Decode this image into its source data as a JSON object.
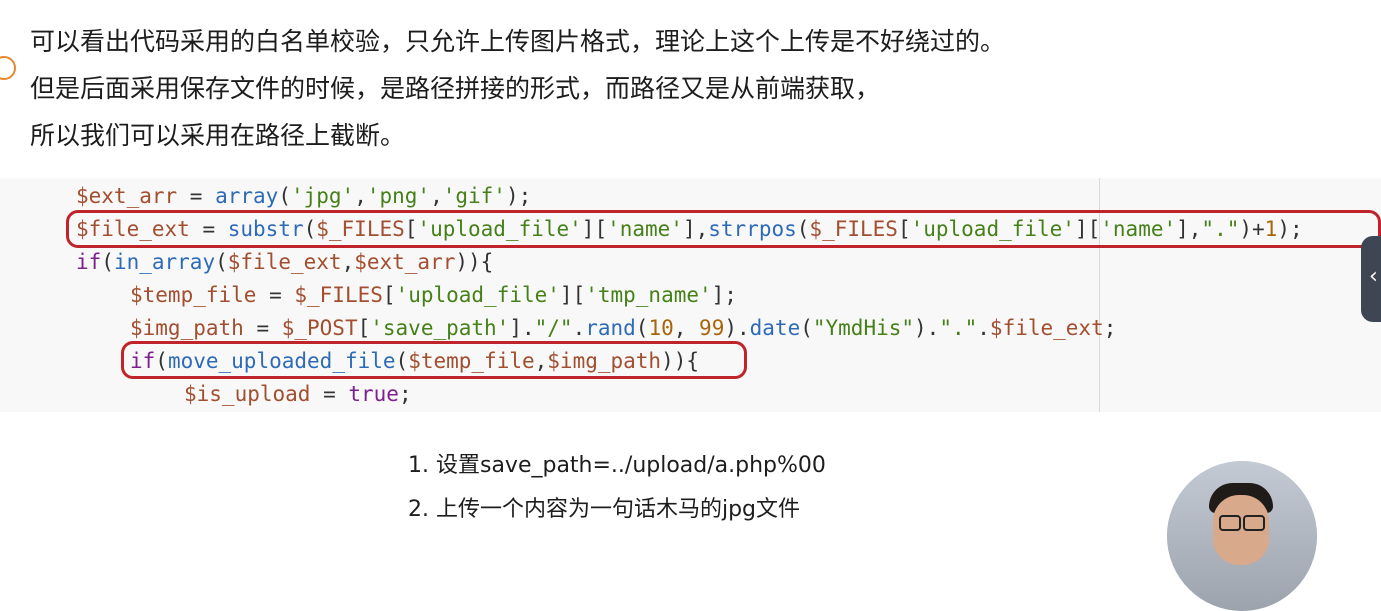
{
  "prose": {
    "line1": "可以看出代码采用的白名单校验，只允许上传图片格式，理论上这个上传是不好绕过的。",
    "line2": "但是后面采用保存文件的时候，是路径拼接的形式，而路径又是从前端获取，",
    "line3": "所以我们可以采用在路径上截断。"
  },
  "code": {
    "l1": {
      "var": "$ext_arr",
      "op1": " = ",
      "fn": "array",
      "p1": "(",
      "s1": "'jpg'",
      "c1": ",",
      "s2": "'png'",
      "c2": ",",
      "s3": "'gif'",
      "end": ");"
    },
    "l2": {
      "var": "$file_ext",
      "op1": " = ",
      "fn1": "substr",
      "p1": "(",
      "v2": "$_FILES",
      "b1": "[",
      "s1": "'upload_file'",
      "b2": "][",
      "s2": "'name'",
      "b3": "],",
      "fn2": "strrpos",
      "p2": "(",
      "v3": "$_FILES",
      "b4": "[",
      "s3": "'upload_file'",
      "b5": "][",
      "s4": "'name'",
      "b6": "],",
      "s5": "\".\"",
      "p3": ")+",
      "n1": "1",
      "end": ");"
    },
    "l3": {
      "kw": "if",
      "p1": "(",
      "fn": "in_array",
      "p2": "(",
      "v1": "$file_ext",
      "c1": ",",
      "v2": "$ext_arr",
      "end": ")){"
    },
    "l4": {
      "var": "$temp_file",
      "op1": " = ",
      "v2": "$_FILES",
      "b1": "[",
      "s1": "'upload_file'",
      "b2": "][",
      "s2": "'tmp_name'",
      "end": "];"
    },
    "l5": {
      "var": "$img_path",
      "op1": " = ",
      "v2": "$_POST",
      "b1": "[",
      "s1": "'save_path'",
      "b2": "].",
      "s2": "\"/\"",
      "d1": ".",
      "fn1": "rand",
      "p1": "(",
      "n1": "10",
      "c1": ", ",
      "n2": "99",
      "p2": ").",
      "fn2": "date",
      "p3": "(",
      "s3": "\"YmdHis\"",
      "p4": ").",
      "s4": "\".\"",
      "d2": ".",
      "v3": "$file_ext",
      "end": ";"
    },
    "l6": {
      "kw": "if",
      "p1": "(",
      "fn": "move_uploaded_file",
      "p2": "(",
      "v1": "$temp_file",
      "c1": ",",
      "v2": "$img_path",
      "end": ")){"
    },
    "l7": {
      "var": "$is_upload",
      "op1": " = ",
      "kw": "true",
      "end": ";"
    }
  },
  "steps": {
    "s1": "1. 设置save_path=../upload/a.php%00",
    "s2": "2. 上传一个内容为一句话木马的jpg文件"
  },
  "side_tab": {
    "glyph": "‹"
  },
  "colors": {
    "highlight": "#c0232a",
    "code_background": "#f8f8f9",
    "marker": "#e8872e"
  }
}
